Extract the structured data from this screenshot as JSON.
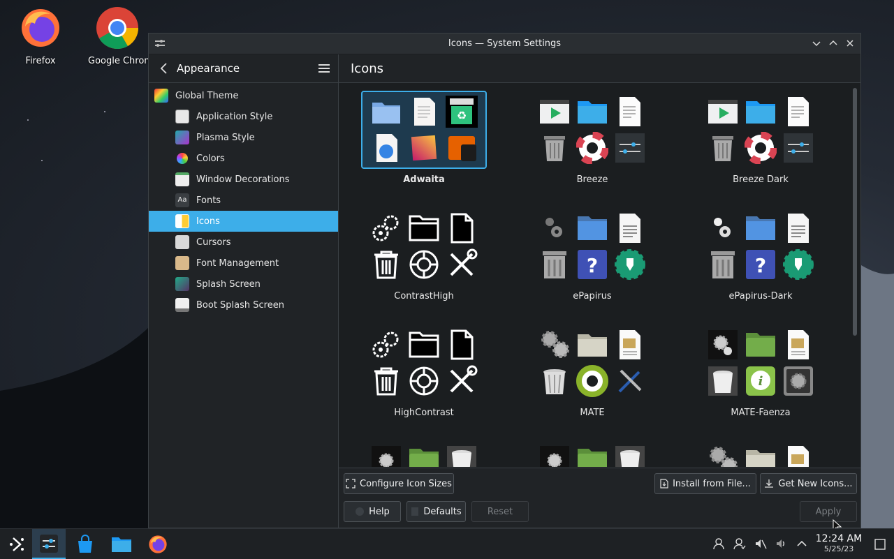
{
  "desktop": {
    "icons": [
      {
        "label": "Firefox"
      },
      {
        "label": "Google Chrome"
      }
    ]
  },
  "window": {
    "title": "Icons — System Settings"
  },
  "sidebar": {
    "header": "Appearance",
    "items": [
      {
        "label": "Global Theme",
        "level": "top"
      },
      {
        "label": "Application Style",
        "level": "sub"
      },
      {
        "label": "Plasma Style",
        "level": "sub"
      },
      {
        "label": "Colors",
        "level": "sub"
      },
      {
        "label": "Window Decorations",
        "level": "sub"
      },
      {
        "label": "Fonts",
        "level": "sub"
      },
      {
        "label": "Icons",
        "level": "sub",
        "active": true
      },
      {
        "label": "Cursors",
        "level": "sub"
      },
      {
        "label": "Font Management",
        "level": "sub"
      },
      {
        "label": "Splash Screen",
        "level": "sub"
      },
      {
        "label": "Boot Splash Screen",
        "level": "sub"
      }
    ]
  },
  "content": {
    "title": "Icons",
    "themes": [
      {
        "name": "Adwaita",
        "selected": true
      },
      {
        "name": "Breeze"
      },
      {
        "name": "Breeze Dark"
      },
      {
        "name": "ContrastHigh"
      },
      {
        "name": "ePapirus"
      },
      {
        "name": "ePapirus-Dark"
      },
      {
        "name": "HighContrast"
      },
      {
        "name": "MATE"
      },
      {
        "name": "MATE-Faenza"
      }
    ]
  },
  "buttons": {
    "configure": "Configure Icon Sizes",
    "install": "Install from File...",
    "get_new": "Get New Icons...",
    "help": "Help",
    "defaults": "Defaults",
    "reset": "Reset",
    "apply": "Apply"
  },
  "taskbar": {
    "time": "12:24 AM",
    "date": "5/25/23"
  },
  "colors": {
    "accent": "#3daee9",
    "window_bg": "#202326",
    "content_bg": "#1b1e20"
  }
}
